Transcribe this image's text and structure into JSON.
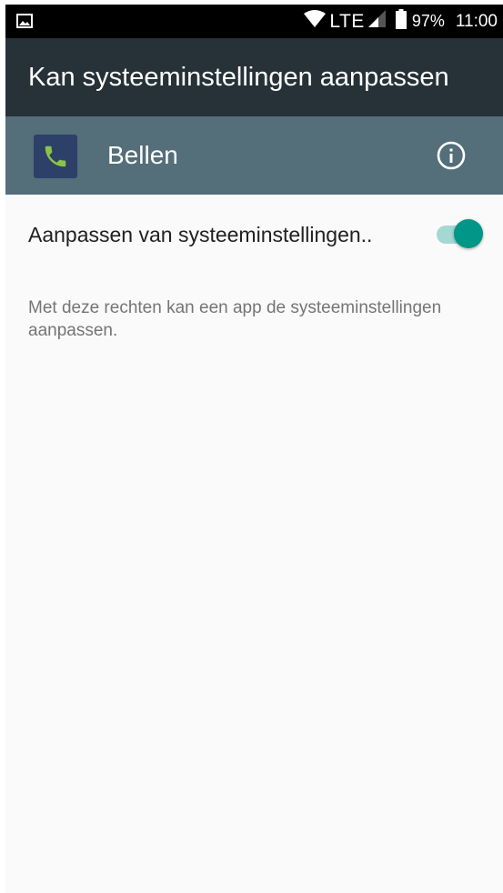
{
  "status_bar": {
    "left_icon": "image-notification-icon",
    "signal_icon": "wifi-icon",
    "network": "LTE",
    "cell_icon": "cell-signal-icon",
    "battery_icon": "battery-icon",
    "battery_percent": "97%",
    "time": "11:00"
  },
  "toolbar": {
    "title": "Kan systeeminstellingen aanpassen"
  },
  "app_header": {
    "icon": "phone-icon",
    "name": "Bellen",
    "info_icon": "info-icon"
  },
  "setting": {
    "label": "Aanpassen van systeeminstellingen..",
    "toggle_on": true
  },
  "description": "Met deze rechten kan een app de systeeminstellingen aanpassen.",
  "colors": {
    "toolbar": "#263238",
    "app_header": "#546e7a",
    "app_icon_bg": "#2d4067",
    "phone_green": "#8bc34a",
    "toggle_thumb": "#009688",
    "toggle_track": "#a4d8d3"
  }
}
